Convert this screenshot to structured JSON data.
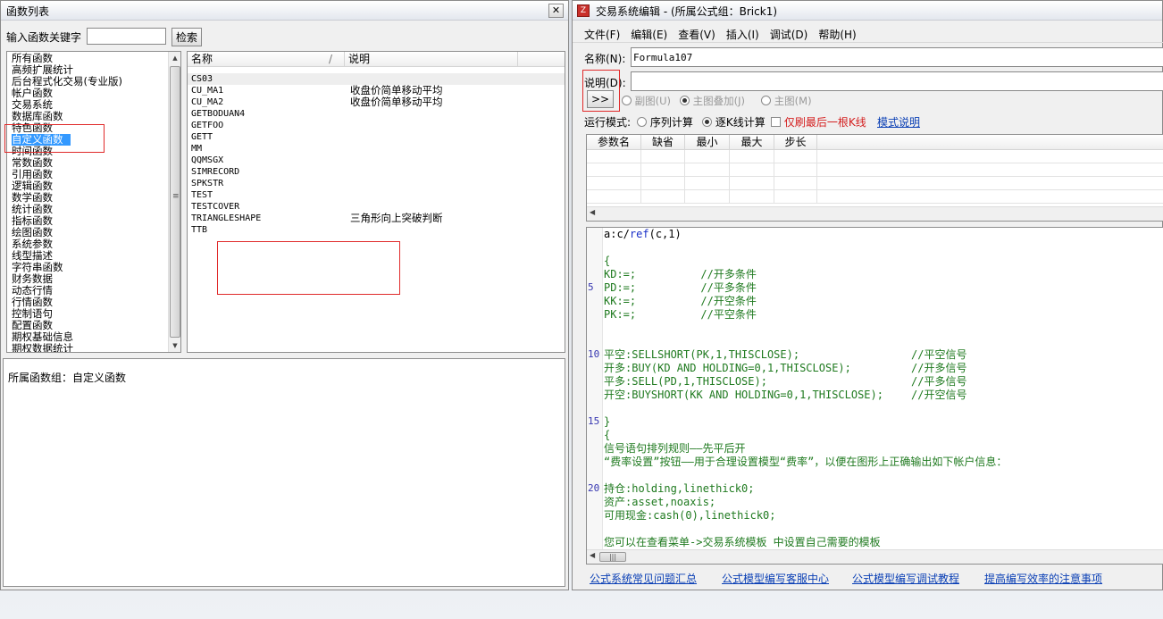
{
  "left_window": {
    "title": "函数列表",
    "close_glyph": "✕",
    "search_label": "输入函数关键字",
    "search_value": "",
    "search_button": "检索",
    "categories": [
      "所有函数",
      "高频扩展统计",
      "后台程式化交易(专业版)",
      "帐户函数",
      "交易系统",
      "数据库函数",
      "特色函数",
      "自定义函数",
      "时间函数",
      "常数函数",
      "引用函数",
      "逻辑函数",
      "数学函数",
      "统计函数",
      "指标函数",
      "绘图函数",
      "系统参数",
      "线型描述",
      "字符串函数",
      "财务数据",
      "动态行情",
      "行情函数",
      "控制语句",
      "配置函数",
      "期权基础信息",
      "期权数据统计"
    ],
    "selected_category": "自定义函数",
    "table_headers": {
      "name": "名称",
      "sort_marker": "/",
      "desc": "说明"
    },
    "functions": [
      {
        "name": "CS03",
        "desc": ""
      },
      {
        "name": "CU_MA1",
        "desc": "收盘价简单移动平均"
      },
      {
        "name": "CU_MA2",
        "desc": "收盘价简单移动平均"
      },
      {
        "name": "GETBODUAN4",
        "desc": ""
      },
      {
        "name": "GETFOO",
        "desc": ""
      },
      {
        "name": "GETT",
        "desc": ""
      },
      {
        "name": "MM",
        "desc": ""
      },
      {
        "name": "QQMSGX",
        "desc": ""
      },
      {
        "name": "SIMRECORD",
        "desc": ""
      },
      {
        "name": "SPKSTR",
        "desc": ""
      },
      {
        "name": "TEST",
        "desc": ""
      },
      {
        "name": "TESTCOVER",
        "desc": ""
      },
      {
        "name": "TRIANGLESHAPE",
        "desc": "三角形向上突破判断"
      },
      {
        "name": "TTB",
        "desc": ""
      }
    ],
    "group_info": "所属函数组：自定义函数"
  },
  "right_window": {
    "title": "交易系统编辑 - (所属公式组：Brick1)",
    "close_glyph": "✕",
    "menu": [
      "文件(F)",
      "编辑(E)",
      "查看(V)",
      "插入(I)",
      "调试(D)",
      "帮助(H)"
    ],
    "name_label": "名称(N):",
    "name_value": "Formula107",
    "desc_label": "说明(D):",
    "desc_value": "",
    "expand_button": ">>",
    "chart_options": [
      "副图(U)",
      "主图叠加(J)",
      "主图(M)"
    ],
    "run_mode_label": "运行模式:",
    "run_modes": [
      "序列计算",
      "逐K线计算"
    ],
    "last_bar_only": "仅刷最后一根K线",
    "mode_help_link": "模式说明",
    "param_headers": [
      "参数名",
      "缺省",
      "最小",
      "最大",
      "步长"
    ],
    "line_numbers": [
      "5",
      "10",
      "15",
      "20"
    ],
    "code": {
      "l1_pre": "a:c/",
      "l1_kw": "ref",
      "l1_post": "(c,1)",
      "block1": "{\nKD:=;          //开多条件\nPD:=;          //平多条件\nKK:=;          //开空条件\nPK:=;          //平空条件",
      "trade_code": "平空:SELLSHORT(PK,1,THISCLOSE);\n开多:BUY(KD AND HOLDING=0,1,THISCLOSE);\n平多:SELL(PD,1,THISCLOSE);\n开空:BUYSHORT(KK AND HOLDING=0,1,THISCLOSE);",
      "trade_comments": "//平空信号\n//开多信号\n//平多信号\n//开空信号",
      "block2": "}\n{\n信号语句排列规则——先平后开\n“费率设置”按钮——用于合理设置模型“费率”，以便在图形上正确输出如下帐户信息：\n\n持仓:holding,linethick0;\n资产:asset,noaxis;\n可用现金:cash(0),linethick0;\n\n您可以在查看菜单->交易系统模板 中设置自己需要的模板"
    },
    "footer_links": [
      "公式系统常见问题汇总",
      "公式模型编写客服中心",
      "公式模型编写调试教程",
      "提高编写效率的注意事项"
    ]
  },
  "colors": {
    "selection": "#3399ff",
    "code_green": "#1f7a1f",
    "keyword_blue": "#1a30c8",
    "annotation_red": "#e02a2a",
    "link": "#0a3fb5"
  }
}
